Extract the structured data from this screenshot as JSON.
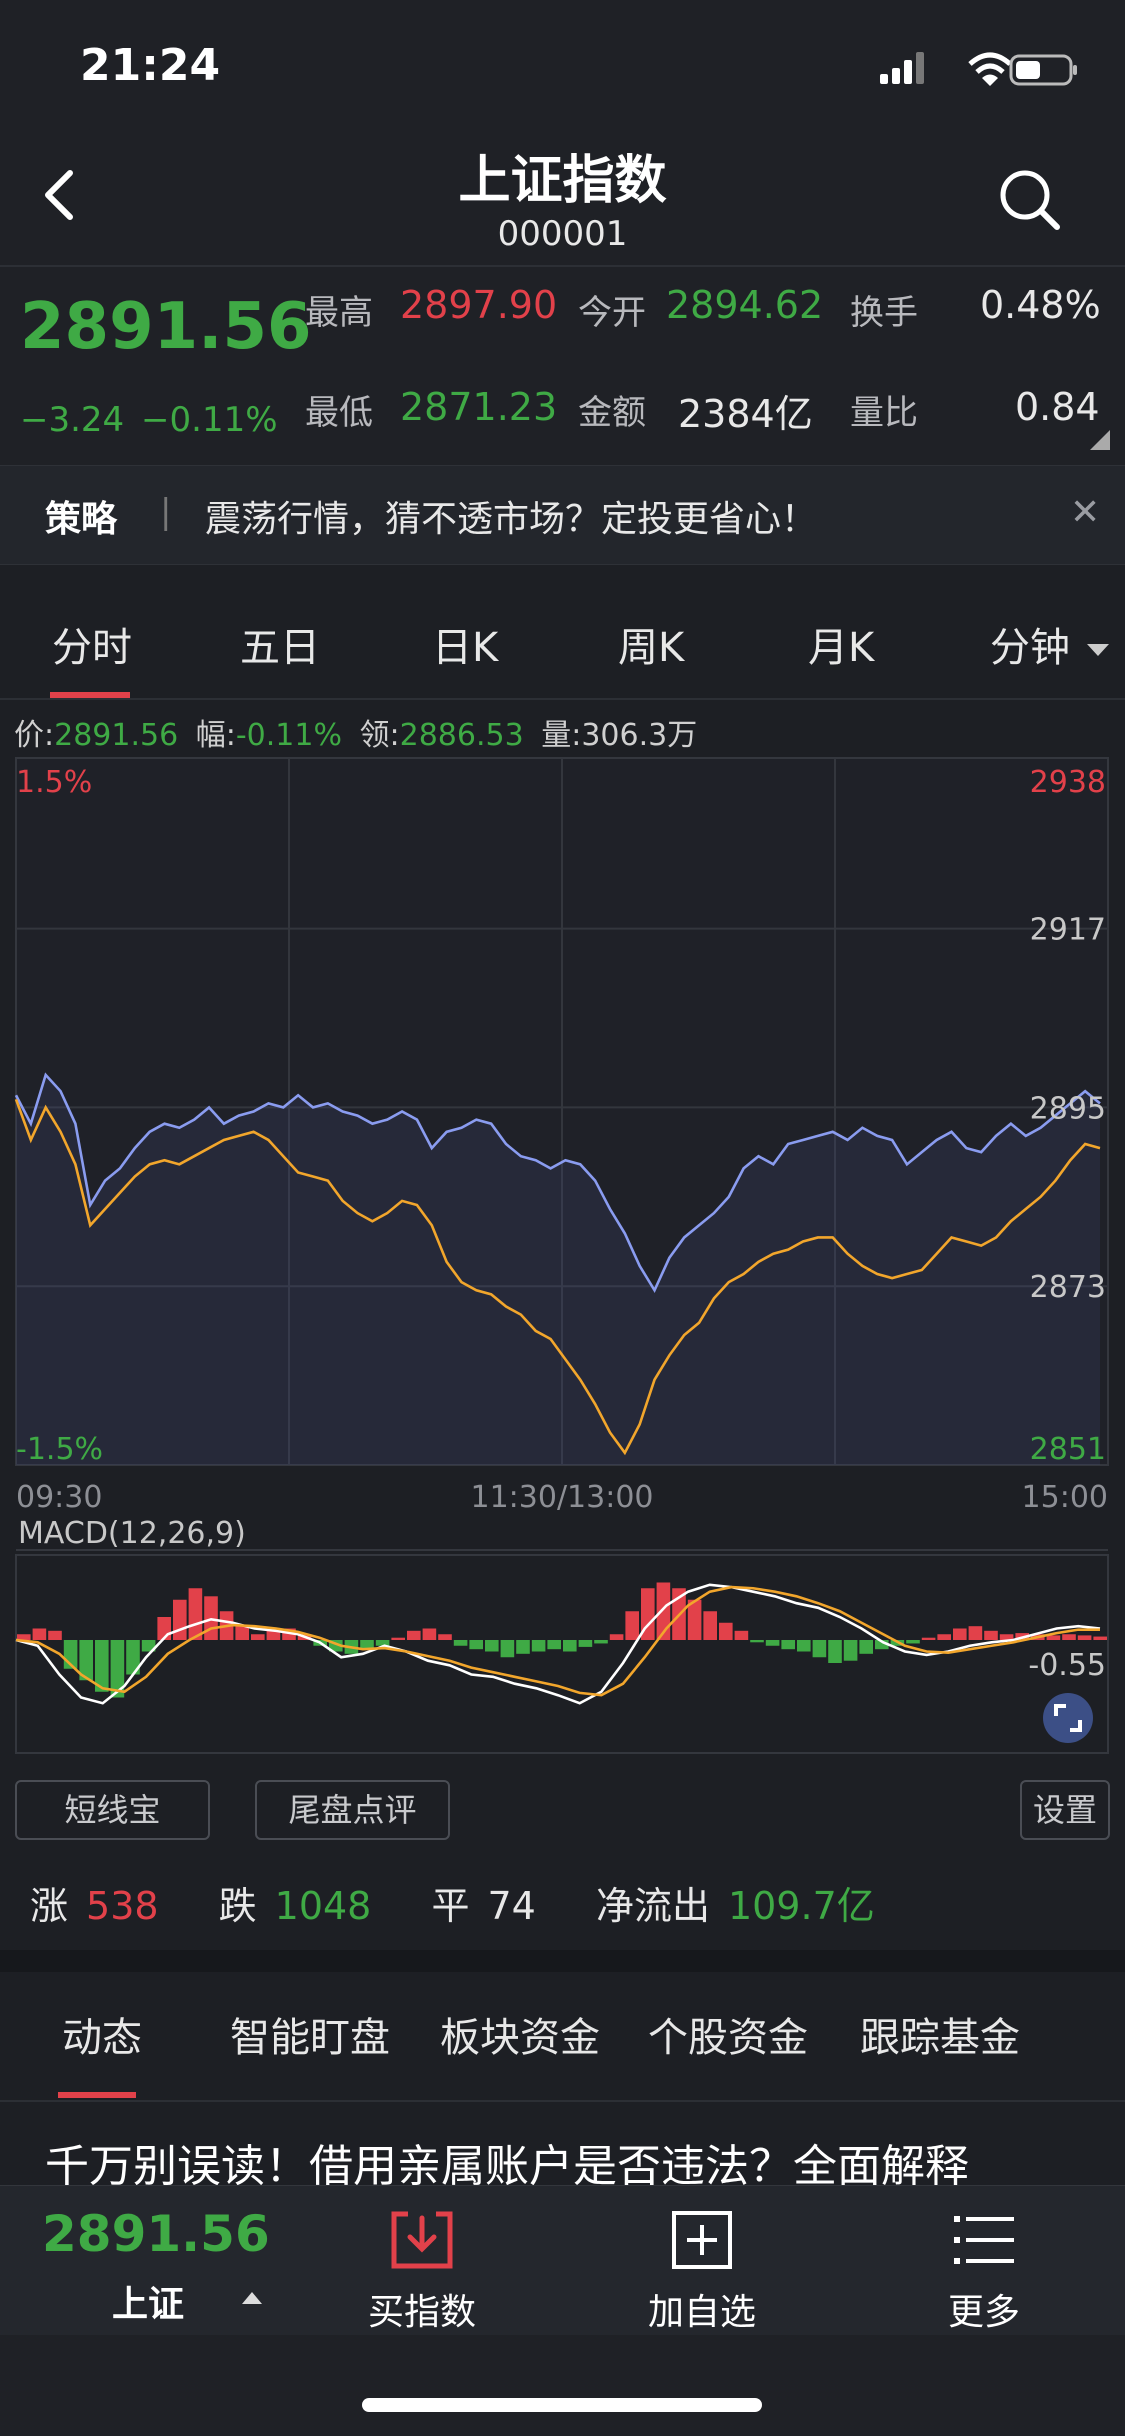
{
  "status_bar": {
    "time": "21:24"
  },
  "header": {
    "title": "上证指数",
    "code": "000001"
  },
  "quote": {
    "price": "2891.56",
    "change": "−3.24",
    "change_pct": "−0.11%",
    "high_label": "最高",
    "high": "2897.90",
    "low_label": "最低",
    "low": "2871.23",
    "open_label": "今开",
    "open": "2894.62",
    "amount_label": "金额",
    "amount": "2384亿",
    "turnover_label": "换手",
    "turnover": "0.48%",
    "volume_ratio_label": "量比",
    "volume_ratio": "0.84"
  },
  "banner": {
    "tag": "策略",
    "separator": "|",
    "text": "震荡行情，猜不透市场？定投更省心！",
    "close": "✕"
  },
  "period_tabs": [
    "分时",
    "五日",
    "日K",
    "周K",
    "月K",
    "分钟"
  ],
  "chart_info": {
    "price_label": "价:",
    "price": "2891.56",
    "amp_label": "幅:",
    "amp": "-0.11%",
    "lead_label": "领:",
    "lead": "2886.53",
    "vol_label": "量:",
    "vol": "306.3万"
  },
  "chart_data": [
    {
      "type": "line",
      "x_ticks": [
        "09:30",
        "11:30/13:00",
        "15:00"
      ],
      "y_ticks_right": [
        "2938",
        "2917",
        "2895",
        "2873",
        "2851"
      ],
      "y_ticks_left": [
        "1.5%",
        "-1.5%"
      ],
      "ylim": [
        2851,
        2938
      ],
      "grid": true,
      "series": [
        {
          "color": "#8a9cf0",
          "values": [
            2896.5,
            2893.0,
            2899.0,
            2897.0,
            2893.0,
            2883.0,
            2886.0,
            2887.5,
            2890.0,
            2892.0,
            2893.0,
            2892.5,
            2893.5,
            2895.0,
            2893.0,
            2894.0,
            2894.5,
            2895.5,
            2895.0,
            2896.5,
            2895.0,
            2895.5,
            2894.5,
            2894.0,
            2893.0,
            2893.5,
            2894.5,
            2893.5,
            2890.0,
            2892.0,
            2892.5,
            2893.5,
            2893.0,
            2890.5,
            2889.0,
            2888.5,
            2887.5,
            2888.5,
            2888.0,
            2886.0,
            2882.5,
            2879.5,
            2875.5,
            2872.5,
            2876.5,
            2879.0,
            2880.5,
            2882.0,
            2884.0,
            2887.5,
            2889.0,
            2888.0,
            2890.5,
            2891.0,
            2891.5,
            2892.0,
            2891.0,
            2892.5,
            2891.5,
            2891.0,
            2888.0,
            2889.5,
            2891.0,
            2892.0,
            2890.0,
            2889.5,
            2891.5,
            2893.0,
            2891.5,
            2892.5,
            2894.0,
            2895.5,
            2897.0,
            2895.5
          ]
        },
        {
          "color": "#f2a62c",
          "values": [
            2896.0,
            2891.0,
            2895.0,
            2892.0,
            2888.0,
            2880.5,
            2882.5,
            2884.5,
            2886.5,
            2888.0,
            2888.5,
            2888.0,
            2889.0,
            2890.0,
            2891.0,
            2891.5,
            2892.0,
            2891.0,
            2889.0,
            2887.0,
            2886.5,
            2886.0,
            2883.5,
            2882.0,
            2881.0,
            2882.0,
            2883.5,
            2883.0,
            2880.5,
            2876.0,
            2873.5,
            2872.5,
            2872.0,
            2870.5,
            2869.5,
            2867.5,
            2866.5,
            2864.0,
            2861.5,
            2858.5,
            2855.0,
            2852.5,
            2856.0,
            2861.5,
            2864.5,
            2867.0,
            2868.5,
            2871.5,
            2873.5,
            2874.5,
            2876.0,
            2877.0,
            2877.5,
            2878.5,
            2879.0,
            2879.0,
            2877.0,
            2875.5,
            2874.5,
            2874.0,
            2874.5,
            2875.0,
            2877.0,
            2879.0,
            2878.5,
            2878.0,
            2879.0,
            2881.0,
            2882.5,
            2884.0,
            2886.0,
            2888.5,
            2890.5,
            2890.0
          ]
        }
      ]
    },
    {
      "type": "bar",
      "title": "MACD(12,26,9)",
      "y_ticks_right": [
        "-0.55"
      ],
      "series": [
        {
          "name": "histogram",
          "values": [
            0.05,
            0.1,
            0.08,
            -0.25,
            -0.35,
            -0.45,
            -0.5,
            -0.3,
            -0.1,
            0.2,
            0.35,
            0.45,
            0.38,
            0.25,
            0.12,
            0.05,
            0.08,
            0.1,
            0.05,
            -0.05,
            -0.1,
            -0.12,
            -0.08,
            -0.05,
            0.02,
            0.08,
            0.1,
            0.05,
            -0.05,
            -0.08,
            -0.1,
            -0.15,
            -0.12,
            -0.1,
            -0.08,
            -0.1,
            -0.06,
            -0.03,
            0.05,
            0.25,
            0.45,
            0.5,
            0.45,
            0.35,
            0.25,
            0.15,
            0.08,
            -0.02,
            -0.05,
            -0.08,
            -0.1,
            -0.15,
            -0.2,
            -0.18,
            -0.12,
            -0.08,
            -0.05,
            -0.03,
            0.02,
            0.05,
            0.1,
            0.12,
            0.08,
            0.05,
            0.06,
            0.05,
            0.04,
            0.05,
            0.04,
            0.03
          ]
        },
        {
          "name": "DIF",
          "color": "#ffffff",
          "values": [
            0.0,
            -0.05,
            -0.3,
            -0.5,
            -0.55,
            -0.4,
            -0.15,
            0.05,
            0.12,
            0.18,
            0.15,
            0.1,
            0.08,
            0.05,
            -0.02,
            -0.15,
            -0.12,
            -0.05,
            -0.1,
            -0.18,
            -0.22,
            -0.3,
            -0.32,
            -0.38,
            -0.42,
            -0.48,
            -0.55,
            -0.45,
            -0.2,
            0.1,
            0.3,
            0.42,
            0.48,
            0.46,
            0.42,
            0.38,
            0.32,
            0.28,
            0.2,
            0.1,
            -0.02,
            -0.1,
            -0.13,
            -0.1,
            -0.05,
            -0.02,
            0.0,
            0.05,
            0.1,
            0.12,
            0.1
          ]
        },
        {
          "name": "DEA",
          "color": "#f2a62c",
          "values": [
            0.0,
            -0.02,
            -0.12,
            -0.3,
            -0.42,
            -0.45,
            -0.32,
            -0.12,
            0.0,
            0.1,
            0.13,
            0.12,
            0.1,
            0.07,
            0.02,
            -0.05,
            -0.08,
            -0.07,
            -0.1,
            -0.14,
            -0.18,
            -0.24,
            -0.28,
            -0.32,
            -0.36,
            -0.4,
            -0.46,
            -0.48,
            -0.38,
            -0.15,
            0.1,
            0.3,
            0.42,
            0.46,
            0.45,
            0.42,
            0.38,
            0.32,
            0.25,
            0.15,
            0.05,
            -0.05,
            -0.1,
            -0.11,
            -0.08,
            -0.05,
            -0.02,
            0.02,
            0.06,
            0.09,
            0.09
          ]
        }
      ]
    }
  ],
  "expand_icon": "expand-icon",
  "buttons": {
    "short_line": "短线宝",
    "closing_review": "尾盘点评",
    "settings": "设置"
  },
  "breadth": {
    "up_label": "涨",
    "up": "538",
    "down_label": "跌",
    "down": "1048",
    "flat_label": "平",
    "flat": "74",
    "flow_label": "净流出",
    "flow": "109.7亿"
  },
  "news_tabs": [
    "动态",
    "智能盯盘",
    "板块资金",
    "个股资金",
    "跟踪基金"
  ],
  "news_headline": "千万别误读！借用亲属账户是否违法？全面解释",
  "bottom_bar": {
    "price": "2891.56",
    "name": "上证",
    "buy_index": "买指数",
    "add_watchlist": "加自选",
    "more": "更多"
  },
  "colors": {
    "red": "#e2414a",
    "green": "#3faa45",
    "accent": "#e2414a",
    "price_line": "#8a9cf0",
    "avg_line": "#f2a62c"
  }
}
